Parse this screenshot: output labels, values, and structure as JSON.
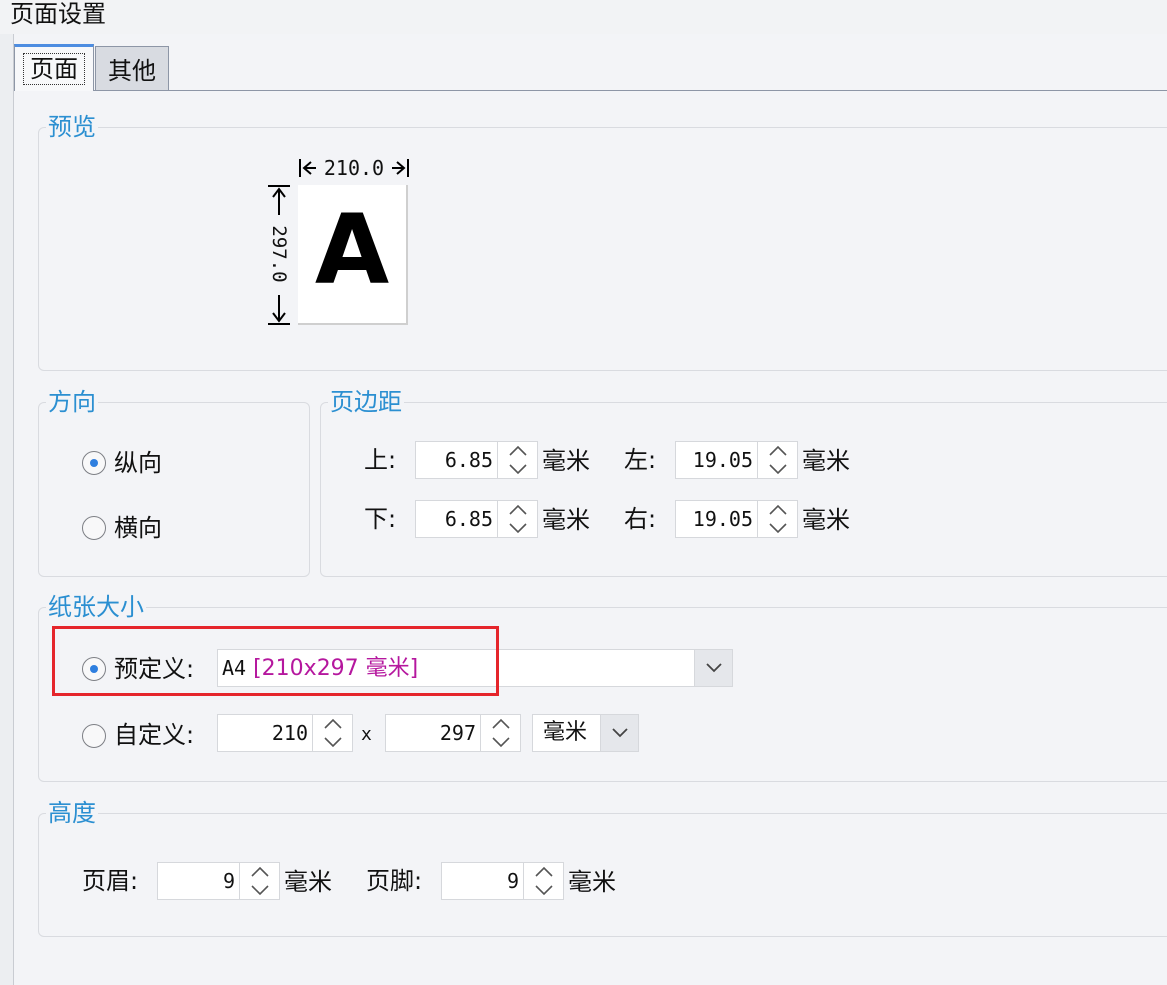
{
  "window": {
    "title": "页面设置"
  },
  "tabs": [
    {
      "label": "页面",
      "active": true
    },
    {
      "label": "其他",
      "active": false
    }
  ],
  "preview": {
    "title": "预览",
    "width_label": "210.0",
    "height_label": "297.0",
    "letter": "A"
  },
  "orientation": {
    "title": "方向",
    "options": [
      {
        "label": "纵向",
        "checked": true
      },
      {
        "label": "横向",
        "checked": false
      }
    ]
  },
  "margins": {
    "title": "页边距",
    "unit": "毫米",
    "top": {
      "label": "上:",
      "value": "6.85"
    },
    "bottom": {
      "label": "下:",
      "value": "6.85"
    },
    "left": {
      "label": "左:",
      "value": "19.05"
    },
    "right": {
      "label": "右:",
      "value": "19.05"
    }
  },
  "paper_size": {
    "title": "纸张大小",
    "predefined": {
      "label": "预定义:",
      "checked": true,
      "value_name": "A4",
      "value_size": "[210x297 毫米]"
    },
    "custom": {
      "label": "自定义:",
      "checked": false,
      "width": "210",
      "times": "x",
      "height": "297",
      "unit": "毫米"
    }
  },
  "height": {
    "title": "高度",
    "unit": "毫米",
    "header": {
      "label": "页眉:",
      "value": "9"
    },
    "footer": {
      "label": "页脚:",
      "value": "9"
    }
  },
  "colors": {
    "accent": "#2b8fd1",
    "radio_dot": "#2f7fdf",
    "highlight": "#e5252b",
    "size_bracket": "#b5179e"
  },
  "icons": {
    "spin_up": "chevron-up-icon",
    "spin_down": "chevron-down-icon",
    "dropdown": "chevron-down-icon"
  }
}
